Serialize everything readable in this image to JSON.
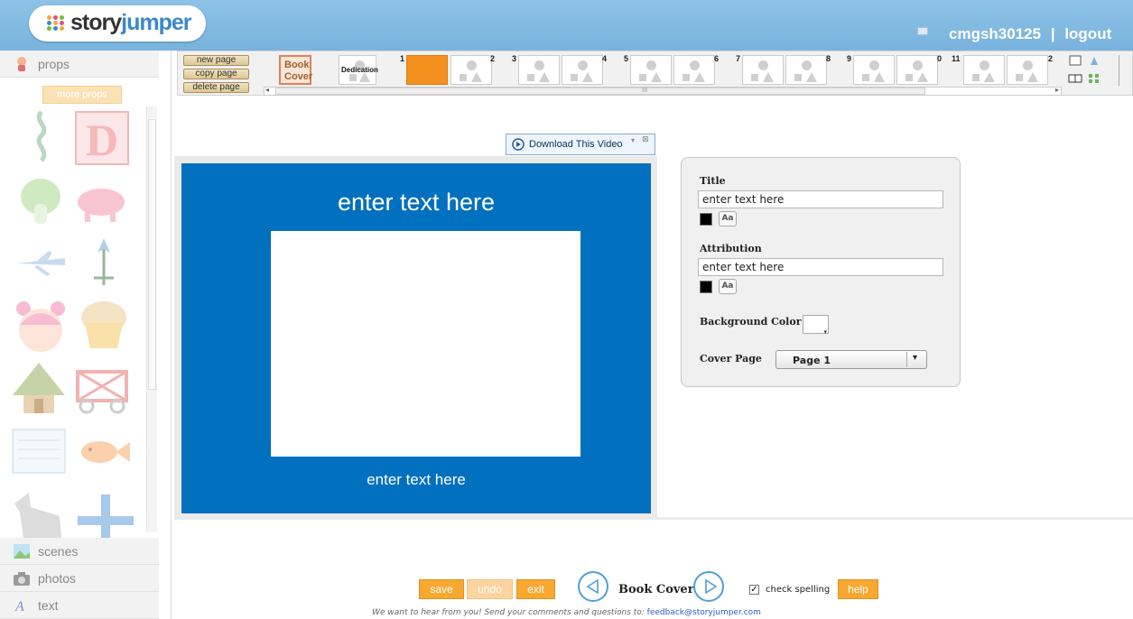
{
  "header": {
    "logo_story": "story",
    "logo_jumper": "jumper",
    "username": "cmgsh30125",
    "separator": "|",
    "logout": "logout",
    "bar_color": "#7eb7e0"
  },
  "sidebar": {
    "props_label": "props",
    "more_props": "more props",
    "props_icons": [
      "ribbon-icon",
      "letter-d-icon",
      "lettuce-icon",
      "pig-icon",
      "airplane-icon",
      "flower-icon",
      "girl-face-icon",
      "muffin-icon",
      "hut-icon",
      "wagon-icon",
      "note-paper-icon",
      "fish-icon",
      "wolf-icon",
      "plus-icon"
    ],
    "scenes_label": "scenes",
    "photos_label": "photos",
    "text_label": "text"
  },
  "pagebar": {
    "new_page": "new page",
    "copy_page": "copy page",
    "delete_page": "delete page",
    "book_cover_line1": "Book",
    "book_cover_line2": "Cover",
    "dedication": "Dedication",
    "page_numbers": [
      "1",
      "2",
      "3",
      "4",
      "5",
      "6",
      "7",
      "8",
      "9",
      "0",
      "11",
      "2"
    ],
    "scroll_marker": "III"
  },
  "video": {
    "download_label": "Download This Video"
  },
  "cover": {
    "title": "enter text here",
    "attribution": "enter text here",
    "background": "#0170be"
  },
  "panel": {
    "title_label": "Title",
    "title_value": "enter text here",
    "attribution_label": "Attribution",
    "attribution_value": "enter text here",
    "aa_label": "Aa",
    "bg_color_label": "Background Color",
    "cover_page_label": "Cover Page",
    "cover_page_value": "Page 1"
  },
  "footer": {
    "save": "save",
    "undo": "undo",
    "exit": "exit",
    "current_page": "Book Cover",
    "check_spelling": "check spelling",
    "help": "help",
    "feedback_text": "We want to hear from you! Send your comments and questions to:",
    "feedback_email": "feedback@storyjumper.com",
    "accent": "#f7a831"
  }
}
